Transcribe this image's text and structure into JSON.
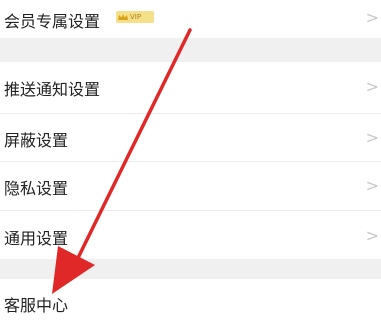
{
  "settings": {
    "items": [
      {
        "label": "会员专属设置",
        "badge": "VIP"
      },
      {
        "label": "推送通知设置",
        "chevron": ">"
      },
      {
        "label": "屏蔽设置",
        "chevron": ">"
      },
      {
        "label": "隐私设置",
        "chevron": ">"
      },
      {
        "label": "通用设置",
        "chevron": ">"
      },
      {
        "label": "客服中心"
      }
    ],
    "first_chevron": ">"
  },
  "colors": {
    "section_gap": "#f0f0f0",
    "chevron": "#c8c8c8",
    "arrow": "#e02828",
    "badge": "#f5e08a"
  },
  "annotation": {
    "icon": "red-arrow-icon"
  }
}
